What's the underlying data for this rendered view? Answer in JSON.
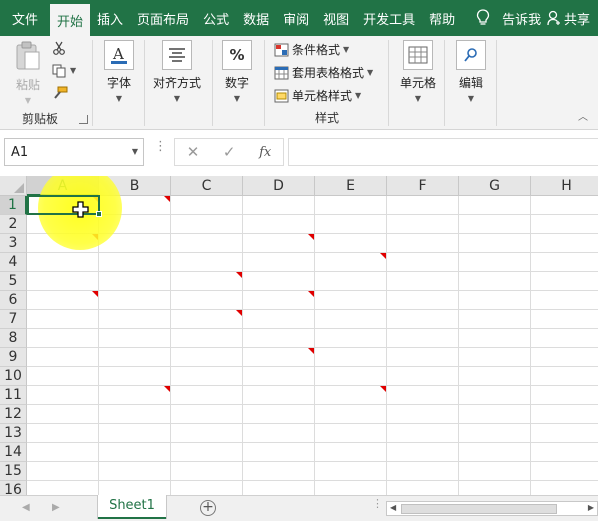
{
  "ribbon_tabs": [
    "文件",
    "开始",
    "插入",
    "页面布局",
    "公式",
    "数据",
    "审阅",
    "视图",
    "开发工具",
    "帮助"
  ],
  "active_tab": "开始",
  "tell_me": "告诉我",
  "share": "共享",
  "clipboard": {
    "paste": "粘贴",
    "group_label": "剪贴板"
  },
  "font": {
    "label": "字体"
  },
  "alignment": {
    "label": "对齐方式"
  },
  "number": {
    "label": "数字",
    "icon_text": "%"
  },
  "styles": {
    "conditional_format": "条件格式",
    "format_as_table": "套用表格格式",
    "cell_styles": "单元格样式",
    "group_label": "样式"
  },
  "cells": {
    "label": "单元格"
  },
  "editing": {
    "label": "编辑"
  },
  "formula_bar": {
    "name_box": "A1",
    "cancel_icon": "✕",
    "enter_icon": "✓",
    "fx_label": "fx",
    "value": ""
  },
  "columns": [
    "A",
    "B",
    "C",
    "D",
    "E",
    "F",
    "G",
    "H"
  ],
  "rows": [
    "1",
    "2",
    "3",
    "4",
    "5",
    "6",
    "7",
    "8",
    "9",
    "10",
    "11",
    "12",
    "13",
    "14",
    "15",
    "16"
  ],
  "active_cell": "A1",
  "comment_cells": [
    "A1",
    "A3",
    "A6",
    "B1",
    "B11",
    "C5",
    "C7",
    "D3",
    "D6",
    "D9",
    "E4",
    "E11"
  ],
  "sheet_tabs": [
    "Sheet1"
  ],
  "active_sheet": "Sheet1",
  "add_sheet": "+",
  "accent_color": "#217346",
  "comment_indicator_color": "#e00000",
  "highlight_color": "#ffff33"
}
